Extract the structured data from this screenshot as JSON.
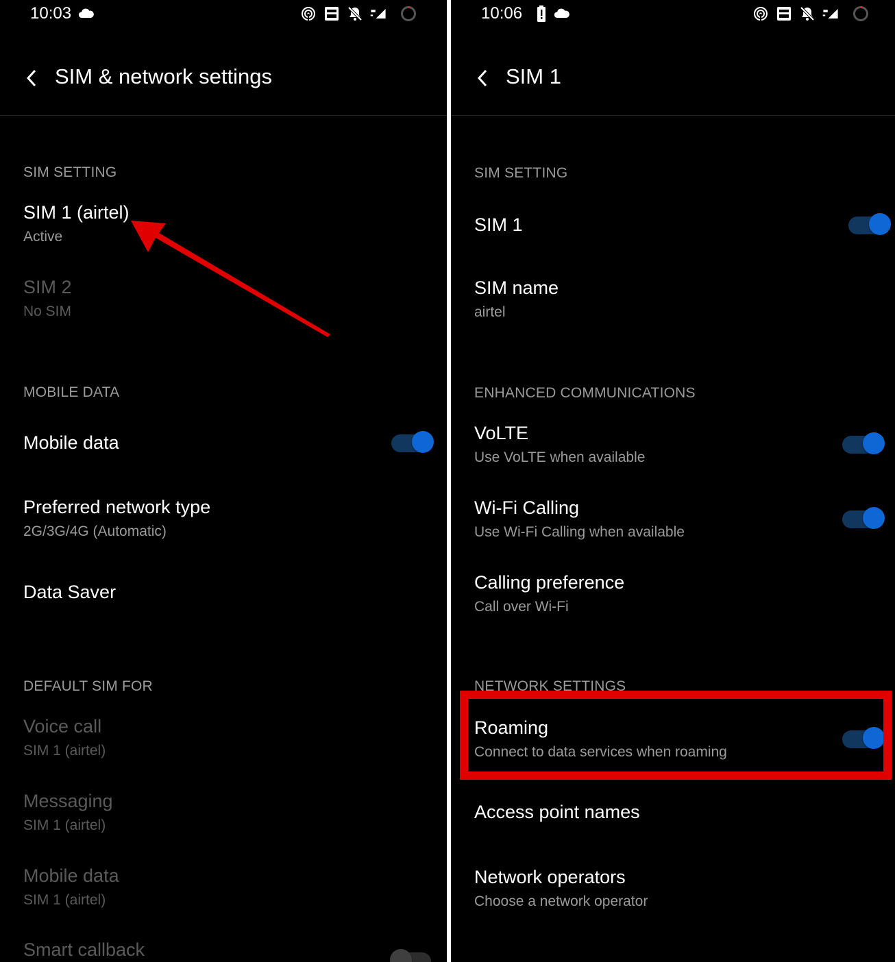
{
  "left": {
    "status": {
      "time": "10:03"
    },
    "title": "SIM & network settings",
    "sim_setting": {
      "header": "SIM SETTING",
      "sim1_title": "SIM 1  (airtel)",
      "sim1_sub": "Active",
      "sim2_title": "SIM 2",
      "sim2_sub": "No SIM"
    },
    "mobile_data": {
      "header": "MOBILE DATA",
      "mobile_data_label": "Mobile data",
      "pref_title": "Preferred network type",
      "pref_sub": "2G/3G/4G (Automatic)",
      "data_saver": "Data Saver"
    },
    "default_sim": {
      "header": "DEFAULT SIM FOR",
      "voice_title": "Voice call",
      "voice_sub": "SIM 1  (airtel)",
      "msg_title": "Messaging",
      "msg_sub": "SIM 1  (airtel)",
      "md_title": "Mobile data",
      "md_sub": "SIM 1  (airtel)",
      "callback_title": "Smart callback"
    }
  },
  "right": {
    "status": {
      "time": "10:06"
    },
    "title": "SIM 1",
    "sim_setting": {
      "header": "SIM SETTING",
      "sim1": "SIM 1",
      "sim_name_title": "SIM name",
      "sim_name_sub": "airtel"
    },
    "enhanced": {
      "header": "ENHANCED COMMUNICATIONS",
      "volte_title": "VoLTE",
      "volte_sub": "Use VoLTE when available",
      "wifi_title": "Wi-Fi Calling",
      "wifi_sub": "Use Wi-Fi Calling when available",
      "calling_title": "Calling preference",
      "calling_sub": "Call over Wi-Fi"
    },
    "network": {
      "header": "NETWORK SETTINGS",
      "roaming_title": "Roaming",
      "roaming_sub": "Connect to data services when roaming",
      "apn": "Access point names",
      "operators_title": "Network operators",
      "operators_sub": "Choose a network operator"
    }
  },
  "icons": {
    "cloud": "cloud-icon",
    "battery_alert": "battery-alert-icon",
    "hotspot": "hotspot-icon",
    "volte": "volte-icon",
    "mute": "bell-off-icon",
    "signal": "signal-4g-icon",
    "ring": "battery-ring-icon"
  },
  "colors": {
    "accent": "#0f67d6",
    "track": "#12375f",
    "annotation": "#e00000"
  }
}
